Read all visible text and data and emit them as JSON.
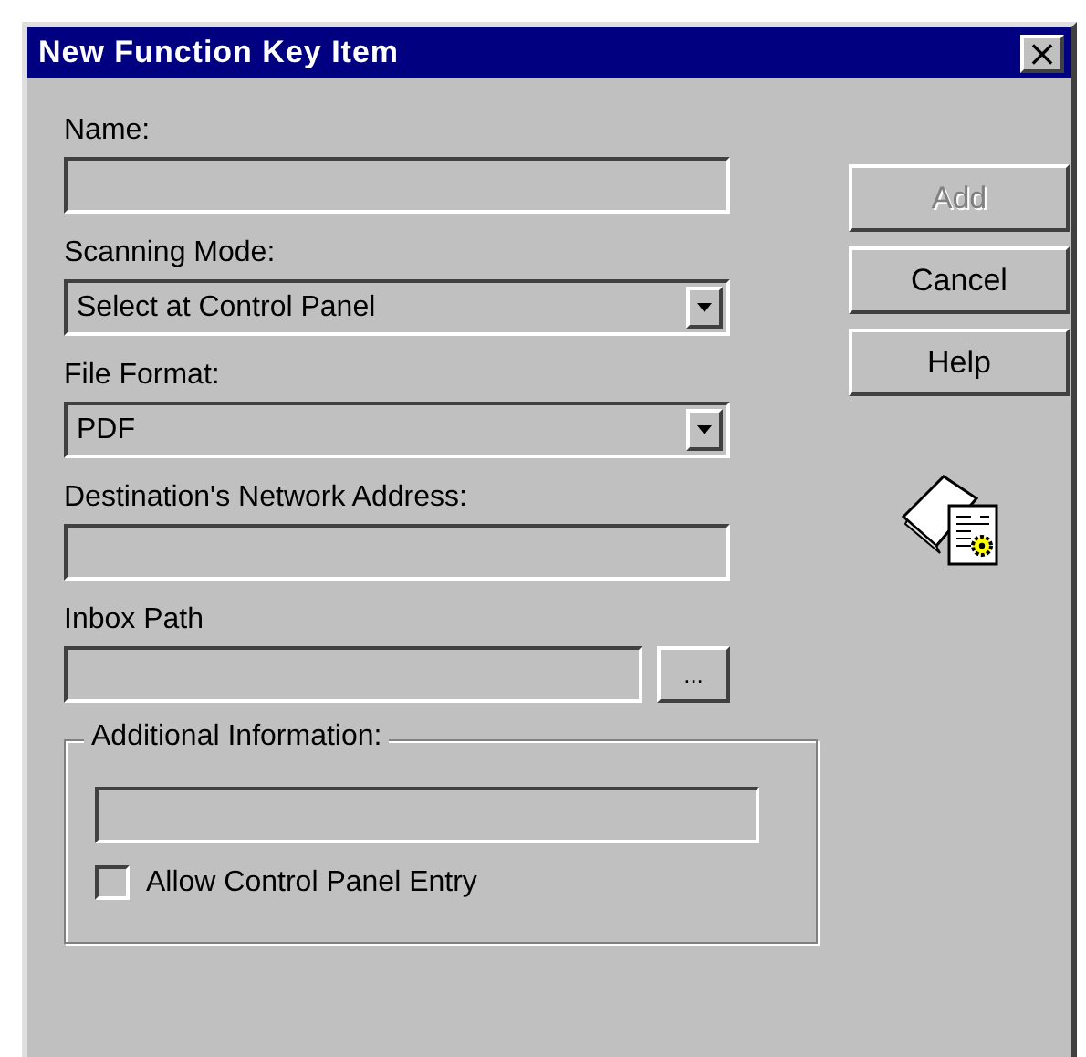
{
  "window": {
    "title": "New Function Key Item",
    "close": "×"
  },
  "fields": [
    {
      "kind": "text",
      "label": "Name:"
    },
    {
      "kind": "select",
      "label": "Scanning Mode:",
      "value": "Select at Control Panel"
    },
    {
      "kind": "select",
      "label": "File Format:",
      "value": "PDF"
    },
    {
      "kind": "text",
      "label": "Destination's Network Address:"
    },
    {
      "kind": "browse",
      "label": "Inbox Path",
      "button": "..."
    }
  ],
  "group": {
    "legend": "Additional Information:",
    "checkbox": {
      "label": "Allow Control Panel Entry",
      "checked": false
    }
  },
  "buttons": [
    {
      "label": "Add",
      "disabled": true
    },
    {
      "label": "Cancel",
      "disabled": false
    },
    {
      "label": "Help",
      "disabled": false
    }
  ]
}
